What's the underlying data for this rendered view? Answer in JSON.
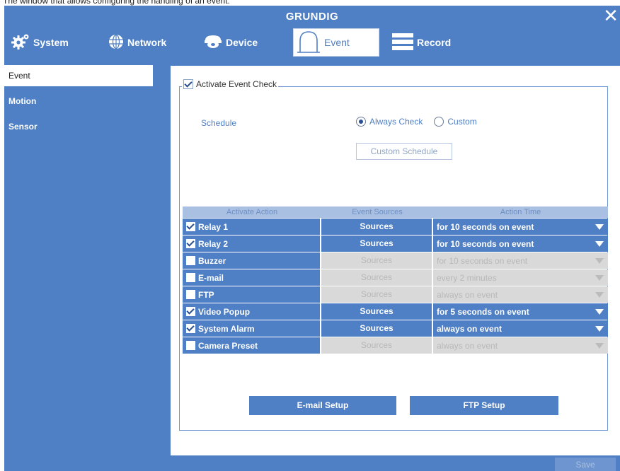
{
  "caption_fragment": "The window that allows configuring the handling of an event:",
  "window": {
    "title": "GRUNDIG"
  },
  "tabs": [
    {
      "label": "System",
      "icon": "gear-icon"
    },
    {
      "label": "Network",
      "icon": "globe-icon"
    },
    {
      "label": "Device",
      "icon": "camera-icon"
    },
    {
      "label": "Event",
      "icon": "alarm-bell-icon",
      "active": true
    },
    {
      "label": "Record",
      "icon": "record-list-icon"
    }
  ],
  "sidebar": {
    "items": [
      {
        "label": "Event",
        "active": true
      },
      {
        "label": "Motion"
      },
      {
        "label": "Sensor"
      }
    ]
  },
  "event": {
    "activate_label": "Activate Event Check",
    "activate_checked": true,
    "schedule_label": "Schedule",
    "schedule_options": [
      "Always Check",
      "Custom"
    ],
    "schedule_selected": "Always Check",
    "custom_schedule_button": "Custom Schedule"
  },
  "table": {
    "headers": [
      "Activate Action",
      "Event Sources",
      "Action Time"
    ],
    "rows": [
      {
        "action": "Relay 1",
        "checked": true,
        "sources": "Sources",
        "time": "for 10 seconds on event"
      },
      {
        "action": "Relay 2",
        "checked": true,
        "sources": "Sources",
        "time": "for 10 seconds on event"
      },
      {
        "action": "Buzzer",
        "checked": false,
        "sources": "Sources",
        "time": "for 10 seconds on event"
      },
      {
        "action": "E-mail",
        "checked": false,
        "sources": "Sources",
        "time": "every 2 minutes"
      },
      {
        "action": "FTP",
        "checked": false,
        "sources": "Sources",
        "time": "always on event"
      },
      {
        "action": "Video Popup",
        "checked": true,
        "sources": "Sources",
        "time": "for 5 seconds on event"
      },
      {
        "action": "System Alarm",
        "checked": true,
        "sources": "Sources",
        "time": "always on event"
      },
      {
        "action": "Camera Preset",
        "checked": false,
        "sources": "Sources",
        "time": "always on event"
      }
    ]
  },
  "buttons": {
    "email_setup": "E-mail Setup",
    "ftp_setup": "FTP Setup",
    "save": "Save"
  },
  "colors": {
    "accent": "#4f7fc4",
    "panel": "#ffffff",
    "disabled_cell": "#d9d9d9"
  }
}
